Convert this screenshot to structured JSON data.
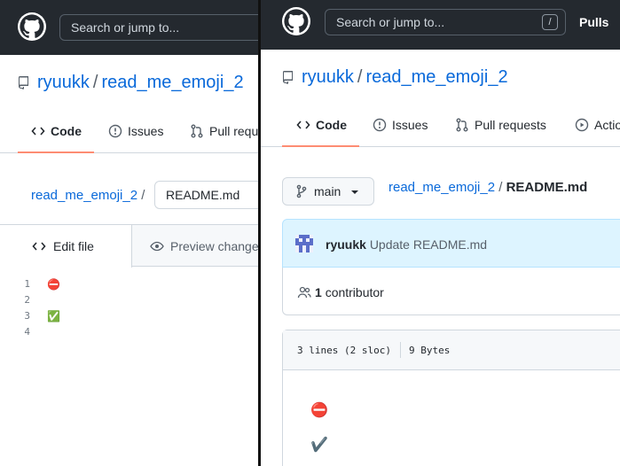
{
  "left": {
    "header": {
      "search_placeholder": "Search or jump to..."
    },
    "repo": {
      "owner": "ryuukk",
      "separator": "/",
      "name": "read_me_emoji_2"
    },
    "tabs": [
      {
        "label": "Code",
        "icon": "code-icon"
      },
      {
        "label": "Issues",
        "icon": "issue-icon"
      },
      {
        "label": "Pull requests",
        "icon": "pull-request-icon"
      }
    ],
    "breadcrumb": {
      "repo": "read_me_emoji_2",
      "separator": "/",
      "filename": "README.md"
    },
    "editor_tabs": {
      "edit": "Edit file",
      "preview": "Preview changes"
    },
    "lines": [
      {
        "number": "1",
        "content": "⛔"
      },
      {
        "number": "2",
        "content": ""
      },
      {
        "number": "3",
        "content": "✅"
      },
      {
        "number": "4",
        "content": ""
      }
    ]
  },
  "right": {
    "header": {
      "search_placeholder": "Search or jump to...",
      "shortcut": "/",
      "pulls": "Pulls"
    },
    "repo": {
      "owner": "ryuukk",
      "separator": "/",
      "name": "read_me_emoji_2"
    },
    "tabs": [
      {
        "label": "Code",
        "icon": "code-icon"
      },
      {
        "label": "Issues",
        "icon": "issue-icon"
      },
      {
        "label": "Pull requests",
        "icon": "pull-request-icon"
      },
      {
        "label": "Actions",
        "icon": "play-icon"
      }
    ],
    "branch": {
      "label": "main"
    },
    "breadcrumb": {
      "repo": "read_me_emoji_2",
      "separator": "/",
      "filename": "README.md"
    },
    "commit": {
      "author": "ryuukk",
      "message": "Update README.md"
    },
    "contributors": {
      "count": "1",
      "label": "contributor"
    },
    "file_info": {
      "lines": "3 lines (2 sloc)",
      "size": "9 Bytes"
    },
    "rendered": [
      "⛔",
      "✔️"
    ]
  },
  "colors": {
    "header_bg": "#24292f",
    "link": "#0969da",
    "active_tab_underline": "#fd8c73"
  }
}
